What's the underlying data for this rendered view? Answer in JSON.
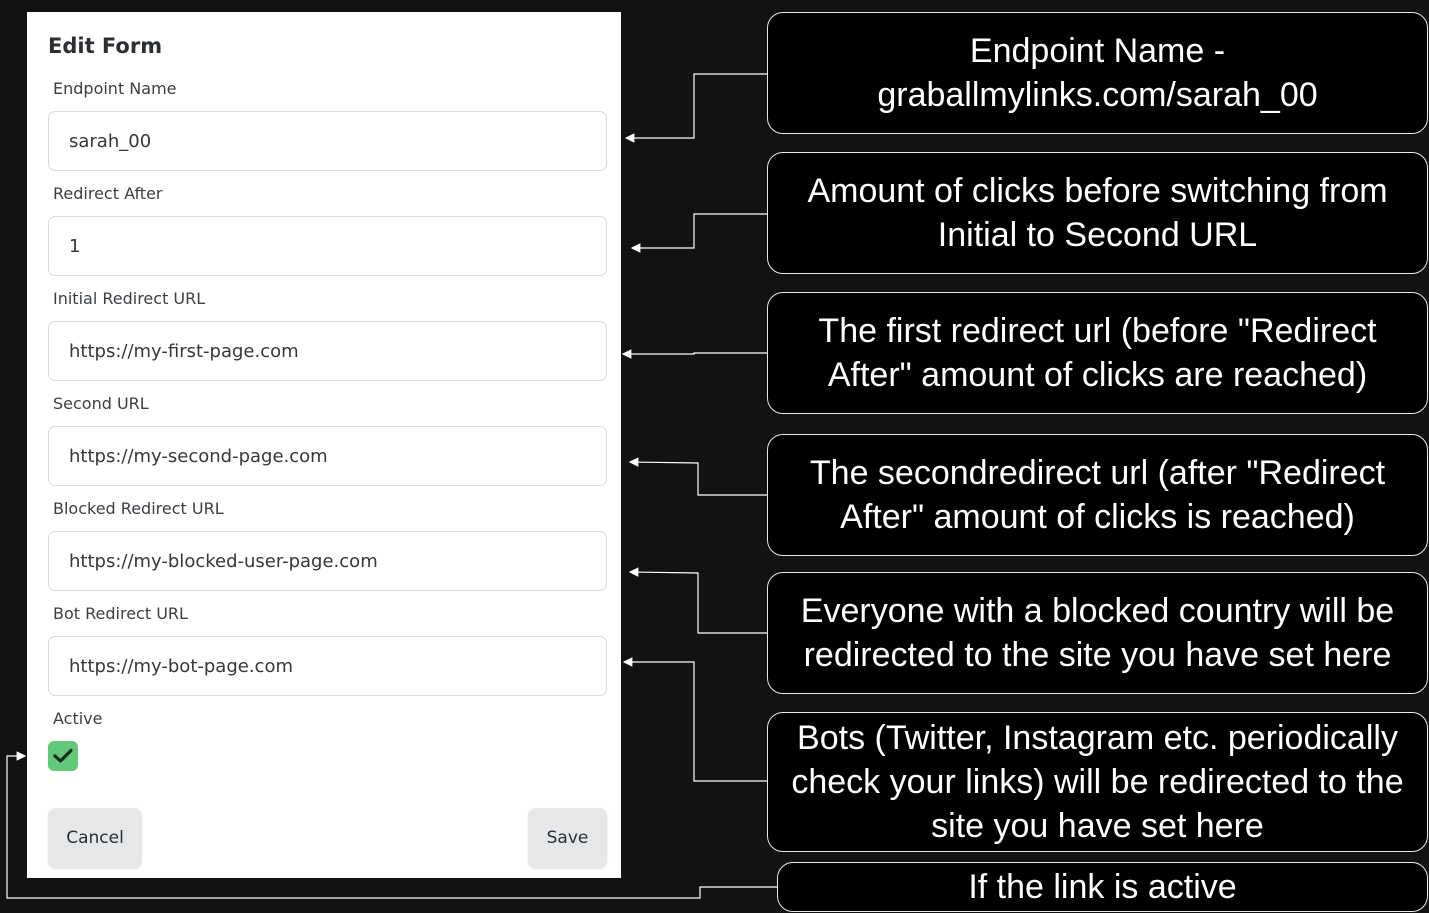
{
  "form": {
    "title": "Edit Form",
    "fields": [
      {
        "label": "Endpoint Name",
        "value": "sarah_00"
      },
      {
        "label": "Redirect After",
        "value": "1"
      },
      {
        "label": "Initial Redirect URL",
        "value": "https://my-first-page.com"
      },
      {
        "label": "Second URL",
        "value": "https://my-second-page.com"
      },
      {
        "label": "Blocked Redirect URL",
        "value": "https://my-blocked-user-page.com"
      },
      {
        "label": "Bot Redirect URL",
        "value": "https://my-bot-page.com"
      }
    ],
    "active": {
      "label": "Active",
      "checked": true,
      "icon": "check-icon"
    },
    "cancel_label": "Cancel",
    "save_label": "Save"
  },
  "annotations": [
    "Endpoint Name - graballmylinks.com/sarah_00",
    "Amount of clicks before switching from Initial to Second URL",
    "The first redirect url (before \"Redirect After\" amount of clicks are reached)",
    "The secondredirect url (after \"Redirect After\" amount of clicks is reached)",
    "Everyone with a blocked country will be redirected to the site you have set here",
    "Bots (Twitter, Instagram etc. periodically check your links) will be redirected to the site you have set here",
    "If the link is active"
  ],
  "colors": {
    "background": "#121212",
    "panel": "#ffffff",
    "checkbox": "#63c97a",
    "button": "#e6e7e9",
    "annotation_box": "#000000",
    "annotation_text": "#ffffff"
  }
}
